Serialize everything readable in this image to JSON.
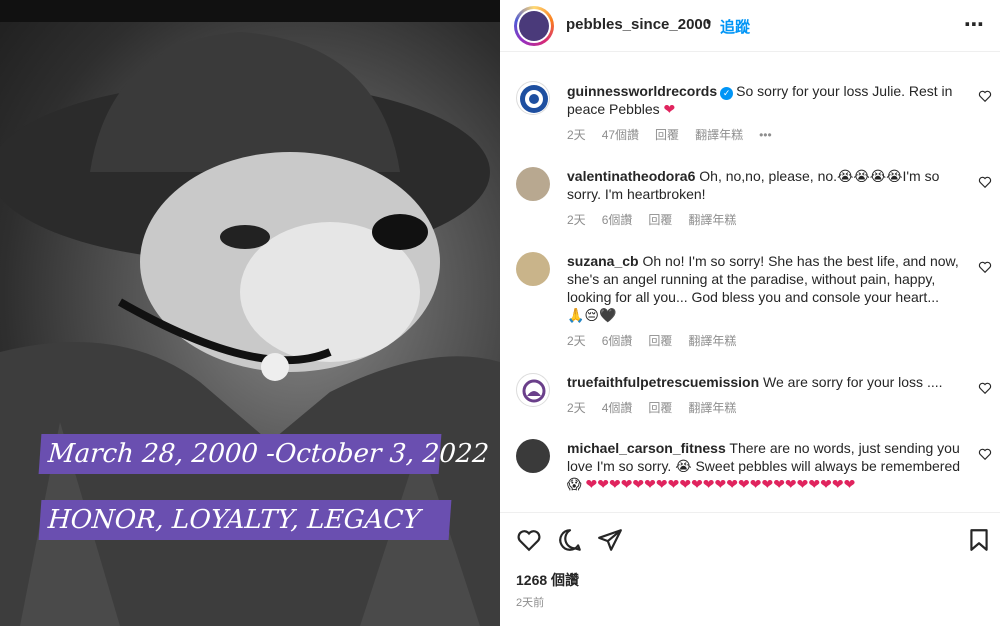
{
  "post": {
    "banner_dates": "March 28, 2000 -October   3, 2022",
    "banner_motto": "HONOR, LOYALTY, LEGACY"
  },
  "header": {
    "username": "pebbles_since_2000",
    "separator": "•",
    "follow_label": "追蹤",
    "more_label": "⋯"
  },
  "comments": [
    {
      "username": "guinnessworldrecords",
      "verified": true,
      "text": "So sorry for your loss Julie. Rest in peace Pebbles",
      "emoji": "❤",
      "time": "2天",
      "likes": "47個讚",
      "reply": "回覆",
      "translate": "翻譯年糕",
      "more": "•••"
    },
    {
      "username": "valentinatheodora6",
      "text": "Oh, no,no, please, no.😭😭😭😭I'm so sorry. I'm heartbroken!",
      "time": "2天",
      "likes": "6個讚",
      "reply": "回覆",
      "translate": "翻譯年糕"
    },
    {
      "username": "suzana_cb",
      "text": "Oh no! I'm so sorry! She has the best life, and now, she's an angel running at the paradise, without pain, happy, looking for all you... God bless you and console your heart...",
      "emoji": "🙏😔🖤",
      "time": "2天",
      "likes": "6個讚",
      "reply": "回覆",
      "translate": "翻譯年糕"
    },
    {
      "username": "truefaithfulpetrescuemission",
      "text": "We are sorry for your loss ....",
      "time": "2天",
      "likes": "4個讚",
      "reply": "回覆",
      "translate": "翻譯年糕"
    },
    {
      "username": "michael_carson_fitness",
      "text": "There are no words, just sending you love I'm so sorry. 😭 Sweet pebbles will always be remembered 😱",
      "emoji": "❤❤❤❤❤❤❤❤❤❤❤❤❤❤❤❤❤❤❤❤❤❤❤"
    }
  ],
  "footer": {
    "likes": "1268 個讚",
    "time": "2天前"
  },
  "colors": {
    "accent": "#0095f6",
    "banner": "#6a4fb0",
    "heart_red": "#e0245e"
  }
}
